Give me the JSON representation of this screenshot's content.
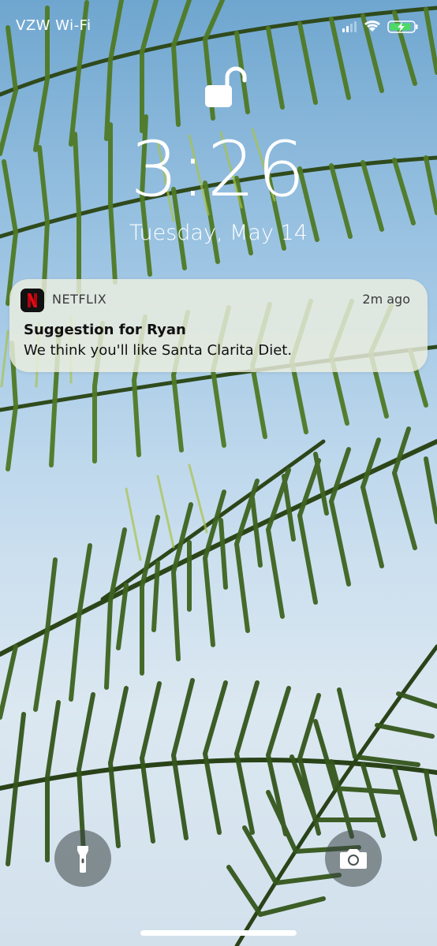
{
  "status_bar": {
    "carrier": "VZW Wi-Fi",
    "icons": [
      "signal-icon",
      "wifi-icon",
      "battery-charging-icon"
    ]
  },
  "lock_screen": {
    "lock_state_icon": "unlocked-padlock-icon",
    "time": "3:26",
    "date": "Tuesday, May 14"
  },
  "notification": {
    "app_icon": "netflix-logo-icon",
    "app_name": "NETFLIX",
    "time_ago": "2m ago",
    "title": "Suggestion for Ryan",
    "body": "We think you'll like Santa Clarita Diet."
  },
  "quick_actions": {
    "left_icon": "flashlight-icon",
    "right_icon": "camera-icon"
  },
  "colors": {
    "netflix_red": "#e50914",
    "battery_green": "#4cd964"
  }
}
